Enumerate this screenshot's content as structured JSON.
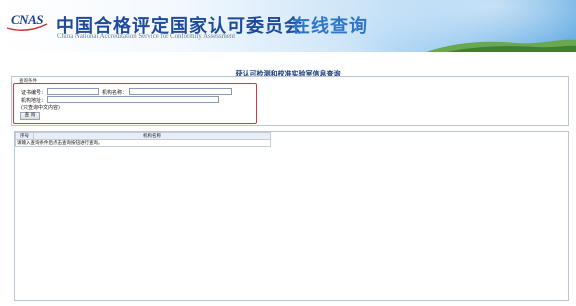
{
  "header": {
    "logo_text": "CNAS",
    "title": "中国合格评定国家认可委员会",
    "subtitle": "在线查询",
    "english_name": "China National Accreditation Service for Conformity Assessment"
  },
  "page": {
    "title": "获认可检测和校准实验室信息查询"
  },
  "search": {
    "legend": "查询条件",
    "cert_no_label": "证书编号：",
    "cert_no_value": "",
    "org_name_label": "机构名称：",
    "org_name_value": "",
    "org_address_label": "机构地址：",
    "org_address_value": "",
    "hint": "(只查询中文内容)",
    "query_button": "查 询"
  },
  "results": {
    "columns": [
      "序号",
      "机构名称"
    ],
    "message": "请输入查询条件后点击查询按钮进行查询。"
  },
  "colors": {
    "brand_blue": "#1d4b9c",
    "accent_blue": "#2f76c6",
    "highlight_red": "#d9363e"
  }
}
